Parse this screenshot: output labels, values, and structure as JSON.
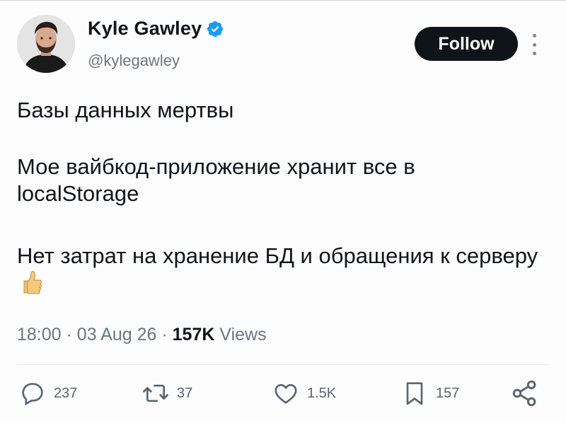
{
  "author": {
    "display_name": "Kyle Gawley",
    "handle": "@kylegawley",
    "verified": true,
    "verified_color": "#1d9bf0"
  },
  "follow_button": {
    "label": "Follow",
    "color": "#0f1419"
  },
  "tweet": {
    "paragraphs": [
      "Базы данных мертвы",
      "Мое вайбкод-приложение хранит все в localStorage",
      "Нет затрат на хранение БД и обращения к серверу"
    ],
    "emoji": "thumbs-up-emoji"
  },
  "meta": {
    "time": "18:00",
    "separator": "·",
    "date": "03 Aug 26",
    "views_count": "157K",
    "views_label": "Views"
  },
  "actions": {
    "replies": "237",
    "reposts": "37",
    "likes": "1.5K",
    "bookmarks": "157"
  },
  "icons": {
    "reply": "reply-icon",
    "repost": "repost-icon",
    "like": "heart-icon",
    "bookmark": "bookmark-icon",
    "share": "share-icon",
    "more": "more-vertical-icon"
  }
}
